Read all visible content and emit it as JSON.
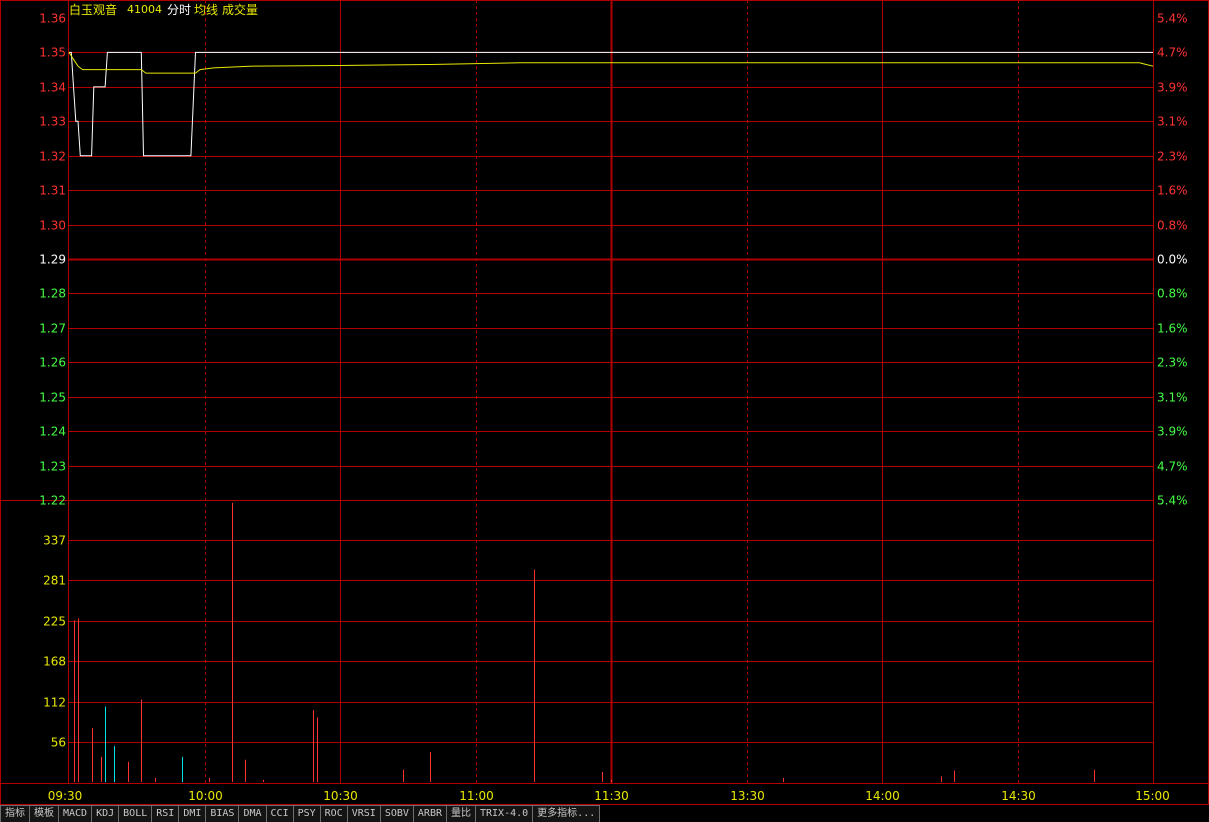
{
  "header": {
    "name": "白玉观音",
    "code": "41004",
    "labels": [
      "分时",
      "均线",
      "成交量"
    ]
  },
  "colors": {
    "grid": "#b00000",
    "up": "#ff3232",
    "down": "#44ff44",
    "flat": "#ffffff",
    "price_line": "#ffffff",
    "avg_line": "#e8e800",
    "volume_axis": "#e8e800",
    "volume_up": "#ff3232",
    "volume_down": "#00e5e5",
    "time_label": "#e8e800"
  },
  "toolbar": {
    "tabs": [
      "指标",
      "模板",
      "MACD",
      "KDJ",
      "BOLL",
      "RSI",
      "DMI",
      "BIAS",
      "DMA",
      "CCI",
      "PSY",
      "ROC",
      "VRSI",
      "SOBV",
      "ARBR",
      "量比",
      "TRIX-4.0",
      "更多指标..."
    ]
  },
  "chart_data": {
    "type": "line",
    "prev_close": 1.29,
    "price_ticks": [
      "1.36",
      "1.35",
      "1.34",
      "1.33",
      "1.32",
      "1.31",
      "1.30",
      "1.29",
      "1.28",
      "1.27",
      "1.26",
      "1.25",
      "1.24",
      "1.23",
      "1.22"
    ],
    "pct_ticks": [
      "5.4%",
      "4.7%",
      "3.9%",
      "3.1%",
      "2.3%",
      "1.6%",
      "0.8%",
      "0.0%",
      "0.8%",
      "1.6%",
      "2.3%",
      "3.1%",
      "3.9%",
      "4.7%",
      "5.4%"
    ],
    "ylim": [
      1.22,
      1.36
    ],
    "time_labels": [
      "09:30",
      "10:00",
      "10:30",
      "11:00",
      "11:30",
      "13:30",
      "14:00",
      "14:30",
      "15:00"
    ],
    "xlim_minutes": [
      0,
      240
    ],
    "series": [
      {
        "x": [
          0,
          0.5,
          1,
          1.5,
          2,
          2.5,
          3,
          4,
          5,
          5.5,
          6,
          7,
          8,
          8.5,
          9,
          16,
          16.5,
          17,
          27,
          27.5,
          28,
          29,
          240
        ],
        "values": [
          1.35,
          1.35,
          1.34,
          1.33,
          1.33,
          1.32,
          1.32,
          1.32,
          1.32,
          1.34,
          1.34,
          1.34,
          1.34,
          1.35,
          1.35,
          1.35,
          1.32,
          1.32,
          1.32,
          1.335,
          1.35,
          1.35,
          1.35
        ]
      },
      {
        "x": [
          0,
          1,
          2,
          3,
          5,
          8,
          9,
          16,
          17,
          20,
          25,
          28,
          29,
          32,
          40,
          60,
          80,
          100,
          140,
          180,
          220,
          237,
          240
        ],
        "values": [
          1.35,
          1.348,
          1.346,
          1.345,
          1.345,
          1.345,
          1.345,
          1.345,
          1.344,
          1.344,
          1.344,
          1.344,
          1.345,
          1.3455,
          1.346,
          1.3462,
          1.3465,
          1.347,
          1.347,
          1.347,
          1.347,
          1.347,
          1.346
        ]
      }
    ],
    "volume": {
      "ticks": [
        "337",
        "281",
        "225",
        "168",
        "112",
        "56"
      ],
      "ylim": [
        0,
        393
      ],
      "bars": [
        {
          "t": 1,
          "v": 225,
          "dir": "up"
        },
        {
          "t": 2,
          "v": 228,
          "dir": "up"
        },
        {
          "t": 5,
          "v": 75,
          "dir": "up"
        },
        {
          "t": 7,
          "v": 35,
          "dir": "up"
        },
        {
          "t": 8,
          "v": 105,
          "dir": "down"
        },
        {
          "t": 10,
          "v": 50,
          "dir": "down"
        },
        {
          "t": 13,
          "v": 28,
          "dir": "up"
        },
        {
          "t": 16,
          "v": 115,
          "dir": "up"
        },
        {
          "t": 19,
          "v": 6,
          "dir": "up"
        },
        {
          "t": 25,
          "v": 35,
          "dir": "down"
        },
        {
          "t": 31,
          "v": 6,
          "dir": "up"
        },
        {
          "t": 36,
          "v": 389,
          "dir": "up"
        },
        {
          "t": 39,
          "v": 31,
          "dir": "up"
        },
        {
          "t": 43,
          "v": 3,
          "dir": "up"
        },
        {
          "t": 54,
          "v": 100,
          "dir": "up"
        },
        {
          "t": 55,
          "v": 90,
          "dir": "up"
        },
        {
          "t": 74,
          "v": 17,
          "dir": "up"
        },
        {
          "t": 80,
          "v": 42,
          "dir": "up"
        },
        {
          "t": 103,
          "v": 296,
          "dir": "up"
        },
        {
          "t": 118,
          "v": 14,
          "dir": "up"
        },
        {
          "t": 120,
          "v": 3,
          "dir": "up"
        },
        {
          "t": 158,
          "v": 6,
          "dir": "up"
        },
        {
          "t": 193,
          "v": 8,
          "dir": "up"
        },
        {
          "t": 196,
          "v": 16,
          "dir": "up"
        },
        {
          "t": 227,
          "v": 17,
          "dir": "up"
        }
      ]
    }
  }
}
